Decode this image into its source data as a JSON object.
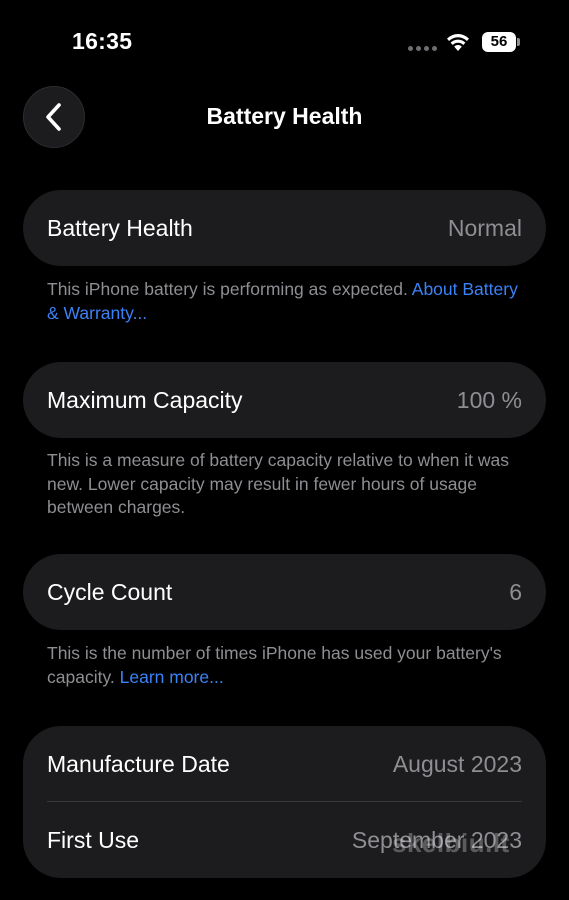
{
  "status_bar": {
    "time": "16:35",
    "battery_level": "56"
  },
  "nav": {
    "title": "Battery Health",
    "back_icon": "chevron-left-icon"
  },
  "battery_health": {
    "label": "Battery Health",
    "value": "Normal",
    "footnote": "This iPhone battery is performing as expected. ",
    "footnote_link": "About Battery & Warranty..."
  },
  "maximum_capacity": {
    "label": "Maximum Capacity",
    "value": "100 %",
    "footnote": "This is a measure of battery capacity relative to when it was new. Lower capacity may result in fewer hours of usage between charges."
  },
  "cycle_count": {
    "label": "Cycle Count",
    "value": "6",
    "footnote": "This is the number of times iPhone has used your battery's capacity. ",
    "footnote_link": "Learn more..."
  },
  "dates": {
    "manufacture_label": "Manufacture Date",
    "manufacture_value": "August 2023",
    "first_use_label": "First Use",
    "first_use_value": "September 2023"
  },
  "watermark": "skelbiu.lt",
  "colors": {
    "background": "#000000",
    "card": "#1c1c1e",
    "secondary_text": "#8e8e93",
    "link": "#3b82f6"
  }
}
